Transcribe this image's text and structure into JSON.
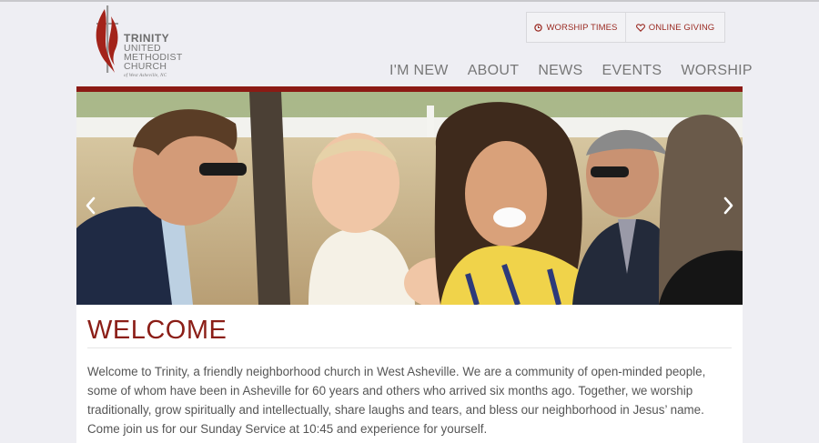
{
  "logo": {
    "line1": "TRINITY",
    "line2": "UNITED",
    "line3": "METHODIST",
    "line4": "CHURCH",
    "line5": "of West Asheville, NC"
  },
  "utility": {
    "worship_times": "WORSHIP TIMES",
    "online_giving": "ONLINE GIVING"
  },
  "nav": {
    "items": [
      "I'M NEW",
      "ABOUT",
      "NEWS",
      "EVENTS",
      "WORSHIP"
    ]
  },
  "hero": {
    "prev_icon": "chevron-left-icon",
    "next_icon": "chevron-right-icon"
  },
  "welcome": {
    "title": "WELCOME",
    "body": "Welcome to Trinity, a friendly neighborhood church in West Asheville.  We are a community of open-minded people, some of whom have been in Asheville for 60 years and others who arrived six months ago.  Together, we worship traditionally, grow spiritually and intellectually, share laughs and tears, and bless our neighborhood in Jesus’ name.  Come join us for our Sunday Service at 10:45 and experience for yourself."
  },
  "colors": {
    "brand_red": "#8b1a14",
    "accent_text": "#9a2a22",
    "background": "#eeeef3"
  }
}
